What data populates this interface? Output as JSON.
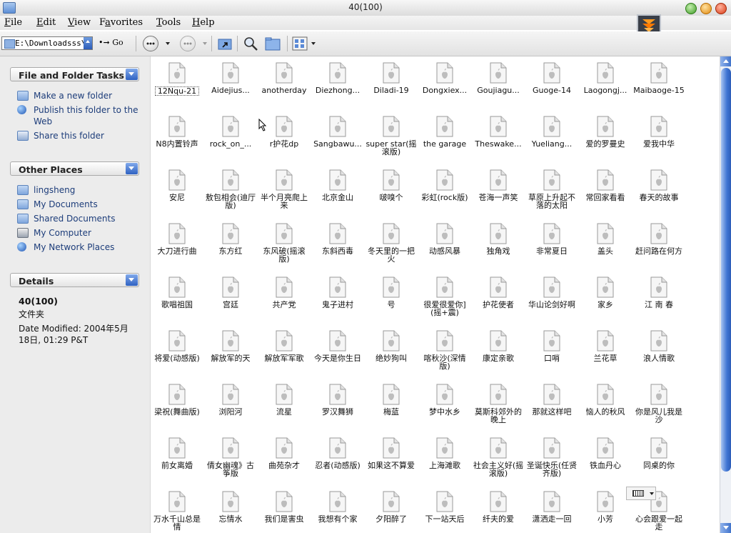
{
  "window": {
    "title": "40(100)"
  },
  "menu": [
    {
      "pre": "",
      "ul": "F",
      "post": "ile"
    },
    {
      "pre": "",
      "ul": "E",
      "post": "dit"
    },
    {
      "pre": "",
      "ul": "V",
      "post": "iew"
    },
    {
      "pre": "F",
      "ul": "a",
      "post": "vorites"
    },
    {
      "pre": "",
      "ul": "T",
      "post": "ools"
    },
    {
      "pre": "",
      "ul": "H",
      "post": "elp"
    }
  ],
  "toolbar": {
    "address": "E:\\Downloadsss\\",
    "go_label": "Go"
  },
  "panels": {
    "tasks": {
      "title": "File and Folder Tasks",
      "items": [
        {
          "label": "Make a new folder",
          "icon": "new-folder-icon"
        },
        {
          "label": "Publish this folder to the Web",
          "icon": "globe-icon"
        },
        {
          "label": "Share this folder",
          "icon": "share-icon"
        }
      ]
    },
    "places": {
      "title": "Other Places",
      "items": [
        {
          "label": "lingsheng",
          "icon": "folder-icon"
        },
        {
          "label": "My Documents",
          "icon": "folder-icon"
        },
        {
          "label": "Shared Documents",
          "icon": "folder-icon"
        },
        {
          "label": "My Computer",
          "icon": "computer-icon"
        },
        {
          "label": "My Network Places",
          "icon": "network-icon"
        }
      ]
    },
    "details": {
      "title": "Details",
      "name": "40(100)",
      "type": "文件夹",
      "modified": "Date Modified: 2004年5月18日, 01:29 P&T"
    }
  },
  "files": [
    "12Nqu-21",
    "Aidejius...",
    "anotherday",
    "Diezhong...",
    "Diladi-19",
    "Dongxiex...",
    "Goujiagu...",
    "Guoge-14",
    "Laogongj...",
    "Maibaoge-15",
    "N8内置铃声",
    "rock_on_...",
    "r护花dp",
    "Sangbawu...",
    "super star(摇滚版)",
    "the garage",
    "Theswake...",
    "Yueliang...",
    "爱的罗曼史",
    "爱我中华",
    "安尼",
    "敖包相会(迪厅版)",
    "半个月亮爬上来",
    "北京金山",
    "啵嗅个",
    "彩虹(rock版)",
    "苍海一声笑",
    "草原上升起不落的太阳",
    "常回家看看",
    "春天的故事",
    "大刀进行曲",
    "东方红",
    "东风破(摇滚版)",
    "东斜西毒",
    "冬天里的一把火",
    "动感风暴",
    "独角戏",
    "非常夏日",
    "盖头",
    "赶问路在何方",
    "歌唱祖国",
    "宫廷",
    "共产党",
    "鬼子进村",
    "号",
    "很爱很爱你](摇+震)",
    "护花使者",
    "华山论剑好啊",
    "家乡",
    "江 南 春",
    "将爱(动感版)",
    "解放军的天",
    "解放军军歌",
    "今天是你生日",
    "绝妙狗叫",
    "喀秋沙(深情版)",
    "康定亲歌",
    "口哨",
    "兰花草",
    "浪人情歌",
    "梁祝(舞曲版)",
    "浏阳河",
    "流星",
    "罗汉舞狮",
    "梅蓝",
    "梦中水乡",
    "莫斯科郊外的晚上",
    "那就这样吧",
    "恼人的秋风",
    "你是风儿我是沙",
    "前女离婚",
    "倩女幽魂》古筝版",
    "曲苑杂才",
    "忍者(动感版)",
    "如果这不算爱",
    "上海滩歌",
    "社会主义好(摇滚版)",
    "圣诞快乐(任贤齐版)",
    "铁血丹心",
    "同桌的你",
    "万水千山总是情",
    "忘情水",
    "我们是害虫",
    "我想有个家",
    "夕阳醉了",
    "下一站天后",
    "纤夫的爱",
    "潇洒走一回",
    "小芳",
    "心会跟爱一起走"
  ]
}
